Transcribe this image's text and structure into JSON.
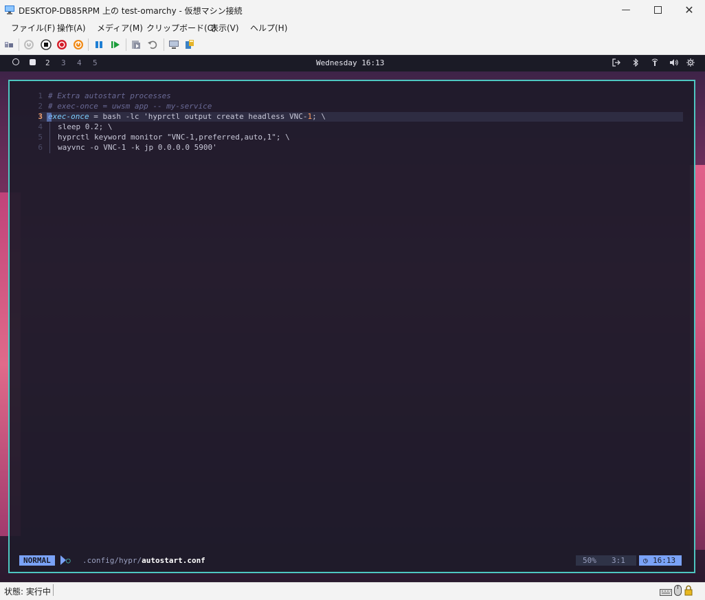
{
  "window": {
    "title": "DESKTOP-DB85RPM 上の test-omarchy  - 仮想マシン接続",
    "minimize_icon": "minimize-icon",
    "maximize_icon": "maximize-icon",
    "close_icon": "close-icon"
  },
  "menu": [
    "ファイル(F)",
    "操作(A)",
    "メディア(M)",
    "クリップボード(C)",
    "表示(V)",
    "ヘルプ(H)"
  ],
  "toolbar": [
    "ctrl-alt-del-icon",
    "start-icon",
    "turn-off-icon",
    "shutdown-icon",
    "save-icon",
    "pause-icon",
    "reset-icon",
    "checkpoint-icon",
    "revert-icon",
    "enhanced-session-icon",
    "share-icon"
  ],
  "waybar": {
    "workspaces": [
      "2",
      "3",
      "4",
      "5"
    ],
    "clock": "Wednesday 16:13"
  },
  "editor": {
    "lines": [
      {
        "n": "1",
        "text": "# Extra autostart processes"
      },
      {
        "n": "2",
        "text": "# exec-once = uwsm app -- my-service"
      },
      {
        "n": "3",
        "kw": "exec-once",
        "rest1": " = bash -lc 'hyprctl output create headless VNC-",
        "num": "1",
        "rest2": "; \\"
      },
      {
        "n": "4",
        "text": "sleep 0.2; \\"
      },
      {
        "n": "5",
        "text": "hyprctl keyword monitor \"VNC-1,preferred,auto,1\"; \\"
      },
      {
        "n": "6",
        "text": "wayvnc -o VNC-1 -k jp 0.0.0.0 5900'"
      }
    ],
    "status": {
      "mode": "NORMAL",
      "path": ".config/hypr/",
      "file": "autostart.conf",
      "percent": "50%",
      "position": "3:1",
      "time": "16:13"
    }
  },
  "statusbar": {
    "state": "状態: 実行中"
  },
  "colors": {
    "accent": "#4ec7c1",
    "mode_bg": "#7aa2f7"
  }
}
